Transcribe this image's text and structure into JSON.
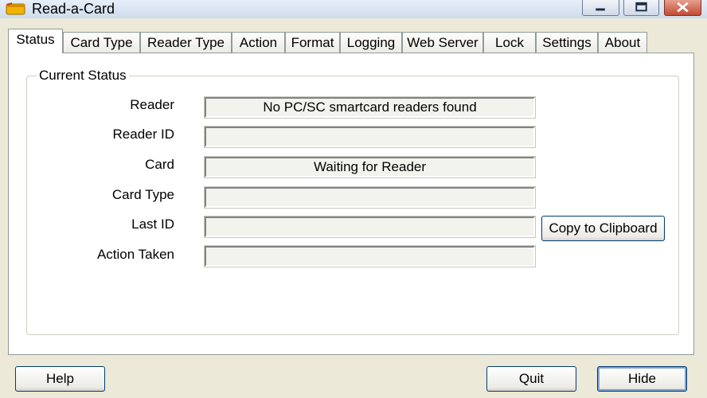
{
  "window": {
    "title": "Read-a-Card",
    "minimize_icon": "minimize-icon",
    "maximize_icon": "maximize-icon",
    "close_icon": "close-icon",
    "app_icon": "card-icon"
  },
  "tabs": [
    {
      "label": "Status",
      "active": true
    },
    {
      "label": "Card Type"
    },
    {
      "label": "Reader Type"
    },
    {
      "label": "Action"
    },
    {
      "label": "Format"
    },
    {
      "label": "Logging"
    },
    {
      "label": "Web Server"
    },
    {
      "label": "Lock"
    },
    {
      "label": "Settings"
    },
    {
      "label": "About"
    }
  ],
  "status": {
    "group_title": "Current Status",
    "rows": [
      {
        "label": "Reader",
        "value": "No PC/SC smartcard readers found"
      },
      {
        "label": "Reader ID",
        "value": ""
      },
      {
        "label": "Card",
        "value": "Waiting for Reader"
      },
      {
        "label": "Card Type",
        "value": ""
      },
      {
        "label": "Last ID",
        "value": ""
      },
      {
        "label": "Action Taken",
        "value": ""
      }
    ],
    "copy_button": "Copy to Clipboard"
  },
  "footer": {
    "help": "Help",
    "quit": "Quit",
    "hide": "Hide"
  },
  "colors": {
    "close_button": "#c34b33",
    "window_bg": "#ece9d8",
    "button_border": "#003c74"
  }
}
